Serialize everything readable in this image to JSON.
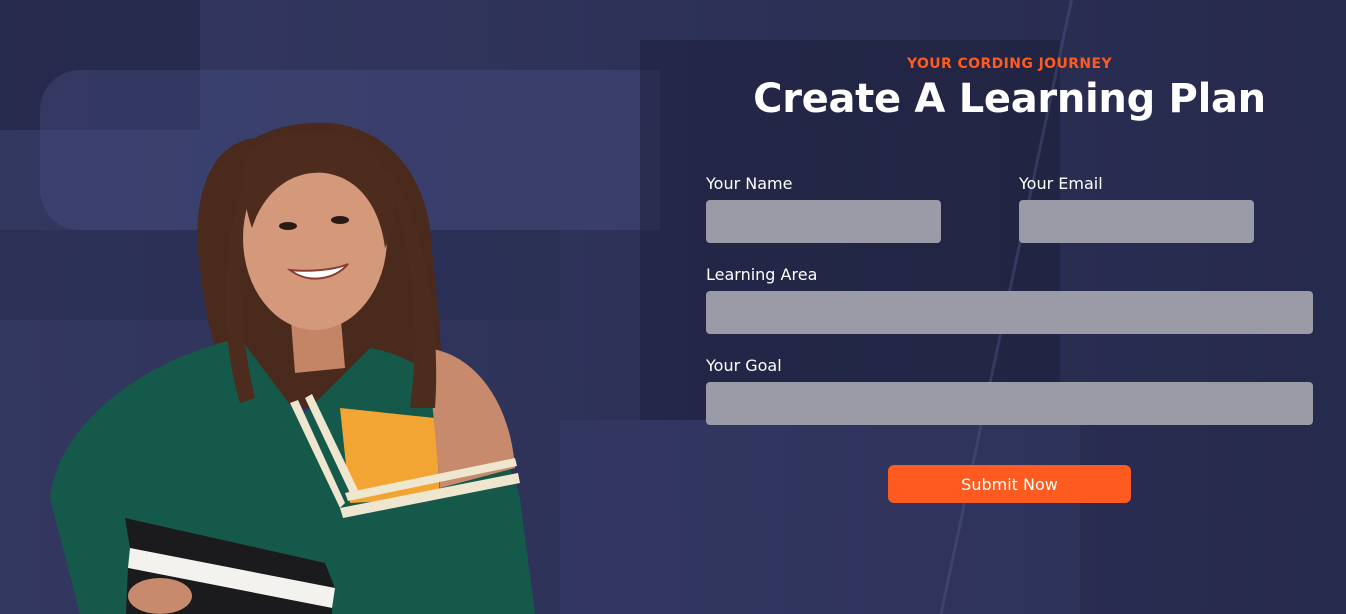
{
  "form": {
    "eyebrow": "YOUR CORDING JOURNEY",
    "title": "Create A Learning Plan",
    "name_label": "Your Name",
    "email_label": "Your Email",
    "area_label": "Learning Area",
    "goal_label": "Your Goal",
    "submit_label": "Submit Now"
  },
  "colors": {
    "accent": "#ff5a1f",
    "background": "#262a4b",
    "field": "#9a9ba7"
  }
}
